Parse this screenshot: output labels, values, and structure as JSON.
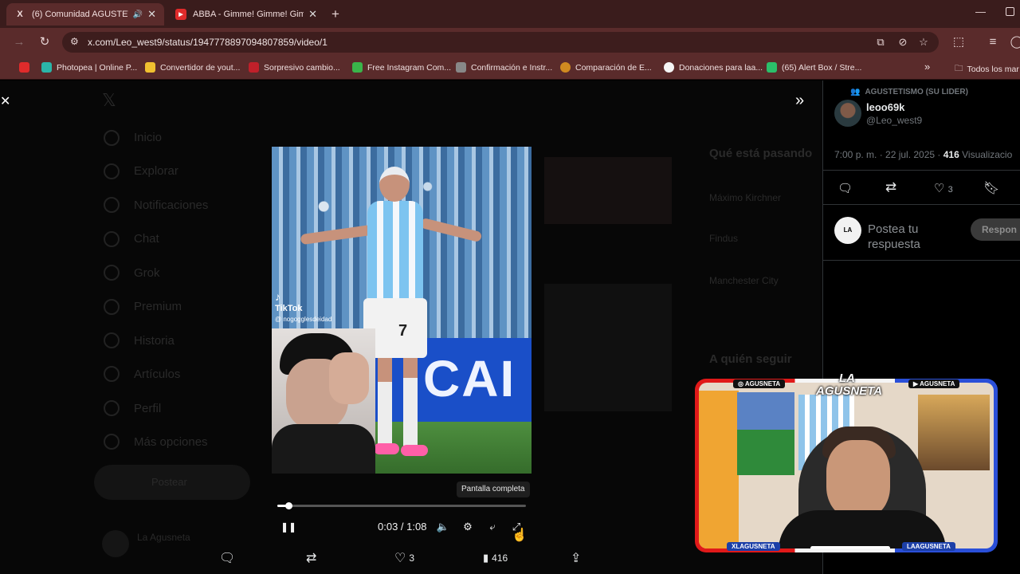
{
  "browser": {
    "tabs": [
      {
        "label": "(6) Comunidad AGUSTETIS",
        "favicon": "x-logo-icon",
        "active": true
      },
      {
        "label": "ABBA - Gimme! Gimme! Gimm",
        "favicon": "youtube-icon",
        "active": false
      }
    ],
    "new_tab_symbol": "+",
    "url": "x.com/Leo_west9/status/1947778897094807859/video/1",
    "bookmarks": [
      {
        "label": "",
        "color": "#e02b2b"
      },
      {
        "label": "Photopea | Online P...",
        "color": "#2bb5a8"
      },
      {
        "label": "Convertidor de yout...",
        "color": "#f0c030"
      },
      {
        "label": "Sorpresivo cambio...",
        "color": "#c0202a"
      },
      {
        "label": "Free Instagram Com...",
        "color": "#3ab54a"
      },
      {
        "label": "Confirmación e Instr...",
        "color": "#888888"
      },
      {
        "label": "Comparación de E...",
        "color": "#d08a20"
      },
      {
        "label": "Donaciones para laa...",
        "color": "#f5f5f5"
      },
      {
        "label": "(65) Alert Box / Stre...",
        "color": "#2bbf6a"
      }
    ],
    "bookmarks_more": "»",
    "all_bookmarks": "Todos los mar"
  },
  "background_sidebar": [
    "Inicio",
    "Explorar",
    "Notificaciones",
    "Chat",
    "Grok",
    "Premium",
    "Historia",
    "Artículos",
    "Perfil",
    "Más opciones"
  ],
  "background_post_button": "Postear",
  "background_user": "La Agusneta",
  "background_trends_title": "Qué está pasando",
  "background_trends": [
    "Máximo Kirchner",
    "Findus",
    "Manchester City"
  ],
  "background_follow_title": "A quién seguir",
  "video": {
    "tiktok_label": "TikTok",
    "tiktok_handle": "@ nogogglesdeidad",
    "shirt_number": "7",
    "banner_text": "CAI",
    "tooltip": "Pantalla completa",
    "time": "0:03 / 1:08",
    "progress": 0.045
  },
  "actions": {
    "likes": "3",
    "views": "416"
  },
  "right_panel": {
    "community": "AGUSTETISMO (SU LIDER)",
    "display_name": "leoo69k",
    "handle": "@Leo_west9",
    "timestamp": "7:00 p. m. · 22 jul. 2025 · ",
    "views_count": "416",
    "views_label": " Visualizacio",
    "likes": "3",
    "reply_placeholder": "Postea tu respuesta",
    "reply_button": "Respon"
  },
  "overlay": {
    "logo": "LA AGUSNETA",
    "instagram_tag": "AGUSNETA",
    "youtube_tag": "AGUSNETA",
    "x_tag": "XLAGUSNETA",
    "tiktok_tag": "LAAGUSNETA"
  }
}
